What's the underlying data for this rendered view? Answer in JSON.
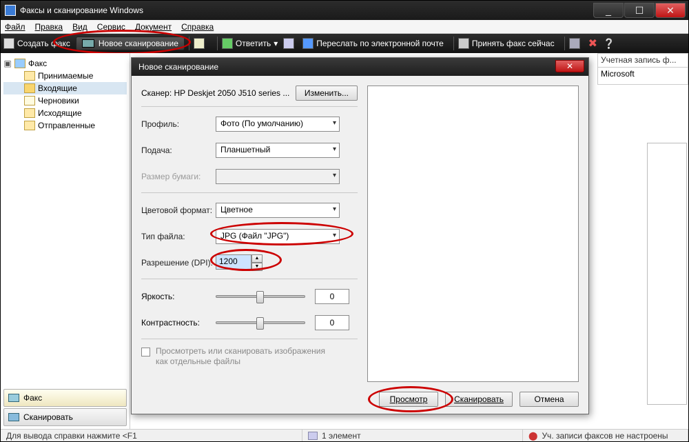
{
  "window": {
    "title": "Факсы и сканирование Windows",
    "min": "_",
    "max": "☐",
    "close": "✕"
  },
  "menu": {
    "file": "Файл",
    "edit": "Правка",
    "view": "Вид",
    "service": "Сервис",
    "document": "Документ",
    "help": "Справка"
  },
  "toolbar": {
    "create_fax": "Создать факс",
    "new_scan": "Новое сканирование",
    "reply": "Ответить",
    "forward": "Переслать по электронной почте",
    "receive": "Принять факс сейчас"
  },
  "tree": {
    "root": "Факс",
    "items": [
      "Принимаемые",
      "Входящие",
      "Черновики",
      "Исходящие",
      "Отправленные"
    ]
  },
  "bottom_tabs": {
    "fax": "Факс",
    "scan": "Сканировать"
  },
  "right": {
    "header": "Учетная запись ф...",
    "row": "Microsoft"
  },
  "dialog": {
    "title": "Новое сканирование",
    "scanner_label": "Сканер:",
    "scanner_name": "HP Deskjet 2050 J510 series ...",
    "change": "Изменить...",
    "profile_lbl": "Профиль:",
    "profile_val": "Фото (По умолчанию)",
    "feed_lbl": "Подача:",
    "feed_val": "Планшетный",
    "paper_lbl": "Размер бумаги:",
    "paper_val": "",
    "color_lbl": "Цветовой формат:",
    "color_val": "Цветное",
    "filetype_lbl": "Тип файла:",
    "filetype_val": "JPG (Файл \"JPG\")",
    "dpi_lbl": "Разрешение (DPI):",
    "dpi_val": "1200",
    "bright_lbl": "Яркость:",
    "bright_val": "0",
    "contrast_lbl": "Контрастность:",
    "contrast_val": "0",
    "chk_lbl": "Просмотреть или сканировать изображения как отдельные файлы",
    "btn_preview": "Просмотр",
    "btn_scan": "Сканировать",
    "btn_cancel": "Отмена"
  },
  "status": {
    "help": "Для вывода справки нажмите <F1",
    "items": "1 элемент",
    "fax": "Уч. записи факсов не настроены"
  }
}
